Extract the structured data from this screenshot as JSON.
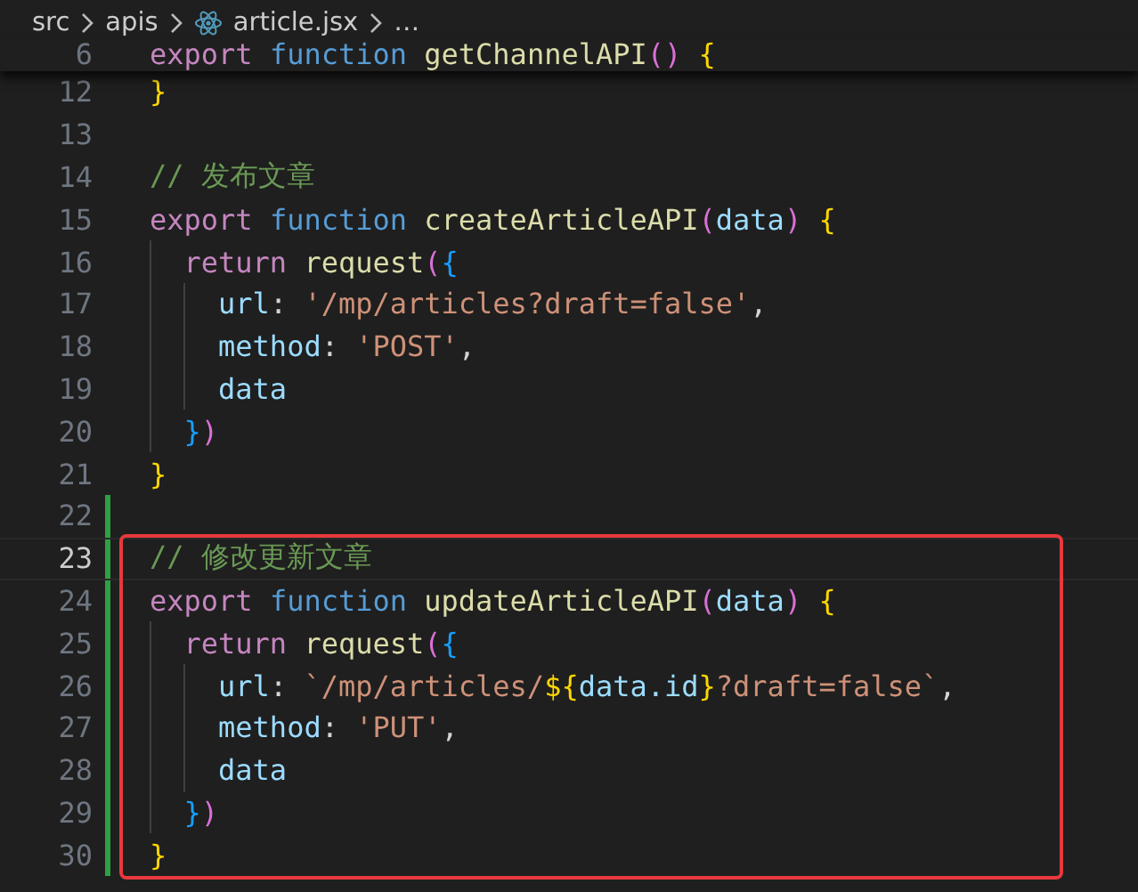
{
  "breadcrumb": [
    {
      "label": "src",
      "kind": "folder"
    },
    {
      "label": "apis",
      "kind": "folder"
    },
    {
      "label": "article.jsx",
      "kind": "react-file"
    },
    {
      "label": "…",
      "kind": "more"
    }
  ],
  "sticky_line": {
    "number": "6",
    "tokens": [
      {
        "t": "export ",
        "color": "#c586c0"
      },
      {
        "t": "function ",
        "color": "#569cd6"
      },
      {
        "t": "getChannelAPI",
        "color": "#dcdcaa"
      },
      {
        "t": "() ",
        "color": "#da70d6"
      },
      {
        "t": "{",
        "color": "#ffd700"
      }
    ]
  },
  "lines": [
    {
      "number": "12",
      "current": false,
      "modified": false,
      "tokens": [
        {
          "t": "}",
          "color": "#ffd700"
        }
      ]
    },
    {
      "number": "13",
      "current": false,
      "modified": false
    },
    {
      "number": "14",
      "current": false,
      "modified": false,
      "tokens": [
        {
          "t": "// 发布文章",
          "color": "#6a9955"
        }
      ]
    },
    {
      "number": "15",
      "current": false,
      "modified": false,
      "tokens": [
        {
          "t": "export ",
          "color": "#c586c0"
        },
        {
          "t": "function ",
          "color": "#569cd6"
        },
        {
          "t": "createArticleAPI",
          "color": "#dcdcaa"
        },
        {
          "t": "(",
          "color": "#da70d6"
        },
        {
          "t": "data",
          "color": "#9cdcfe"
        },
        {
          "t": ") ",
          "color": "#da70d6"
        },
        {
          "t": "{",
          "color": "#ffd700"
        }
      ]
    },
    {
      "number": "16",
      "current": false,
      "modified": false,
      "tokens": [
        {
          "t": "  return ",
          "color": "#c586c0"
        },
        {
          "t": "request",
          "color": "#dcdcaa"
        },
        {
          "t": "(",
          "color": "#da70d6"
        },
        {
          "t": "{",
          "color": "#179fff"
        }
      ]
    },
    {
      "number": "17",
      "current": false,
      "modified": false,
      "tokens": [
        {
          "t": "    url",
          "color": "#9cdcfe"
        },
        {
          "t": ": ",
          "color": "#d4d4d4"
        },
        {
          "t": "'/mp/articles?draft=false'",
          "color": "#ce9178"
        },
        {
          "t": ",",
          "color": "#d4d4d4"
        }
      ]
    },
    {
      "number": "18",
      "current": false,
      "modified": false,
      "tokens": [
        {
          "t": "    method",
          "color": "#9cdcfe"
        },
        {
          "t": ": ",
          "color": "#d4d4d4"
        },
        {
          "t": "'POST'",
          "color": "#ce9178"
        },
        {
          "t": ",",
          "color": "#d4d4d4"
        }
      ]
    },
    {
      "number": "19",
      "current": false,
      "modified": false,
      "tokens": [
        {
          "t": "    data",
          "color": "#9cdcfe"
        }
      ]
    },
    {
      "number": "20",
      "current": false,
      "modified": false,
      "tokens": [
        {
          "t": "  }",
          "color": "#179fff"
        },
        {
          "t": ")",
          "color": "#da70d6"
        }
      ]
    },
    {
      "number": "21",
      "current": false,
      "modified": false,
      "tokens": [
        {
          "t": "}",
          "color": "#ffd700"
        }
      ]
    },
    {
      "number": "22",
      "current": false,
      "modified": true
    }
  ],
  "highlighted_block": {
    "lines": [
      {
        "number": "23",
        "current": true,
        "modified": true,
        "tokens": [
          {
            "t": "// 修改更新文章",
            "color": "#6a9955"
          }
        ]
      },
      {
        "number": "24",
        "current": false,
        "modified": true,
        "tokens": [
          {
            "t": "export ",
            "color": "#c586c0"
          },
          {
            "t": "function ",
            "color": "#569cd6"
          },
          {
            "t": "updateArticleAPI",
            "color": "#dcdcaa"
          },
          {
            "t": "(",
            "color": "#da70d6"
          },
          {
            "t": "data",
            "color": "#9cdcfe"
          },
          {
            "t": ") ",
            "color": "#da70d6"
          },
          {
            "t": "{",
            "color": "#ffd700"
          }
        ]
      },
      {
        "number": "25",
        "current": false,
        "modified": true,
        "tokens": [
          {
            "t": "  return ",
            "color": "#c586c0"
          },
          {
            "t": "request",
            "color": "#dcdcaa"
          },
          {
            "t": "(",
            "color": "#da70d6"
          },
          {
            "t": "{",
            "color": "#179fff"
          }
        ]
      },
      {
        "number": "26",
        "current": false,
        "modified": true,
        "tokens": [
          {
            "t": "    url",
            "color": "#9cdcfe"
          },
          {
            "t": ": ",
            "color": "#d4d4d4"
          },
          {
            "t": "`/mp/articles/",
            "color": "#ce9178"
          },
          {
            "t": "${",
            "color": "#ffd700"
          },
          {
            "t": "data.id",
            "color": "#9cdcfe"
          },
          {
            "t": "}",
            "color": "#ffd700"
          },
          {
            "t": "?draft=false`",
            "color": "#ce9178"
          },
          {
            "t": ",",
            "color": "#d4d4d4"
          }
        ]
      },
      {
        "number": "27",
        "current": false,
        "modified": true,
        "tokens": [
          {
            "t": "    method",
            "color": "#9cdcfe"
          },
          {
            "t": ": ",
            "color": "#d4d4d4"
          },
          {
            "t": "'PUT'",
            "color": "#ce9178"
          },
          {
            "t": ",",
            "color": "#d4d4d4"
          }
        ]
      },
      {
        "number": "28",
        "current": false,
        "modified": true,
        "tokens": [
          {
            "t": "    data",
            "color": "#9cdcfe"
          }
        ]
      },
      {
        "number": "29",
        "current": false,
        "modified": true,
        "tokens": [
          {
            "t": "  }",
            "color": "#179fff"
          },
          {
            "t": ")",
            "color": "#da70d6"
          }
        ]
      },
      {
        "number": "30",
        "current": false,
        "modified": true,
        "tokens": [
          {
            "t": "}",
            "color": "#ffd700"
          }
        ]
      }
    ]
  }
}
